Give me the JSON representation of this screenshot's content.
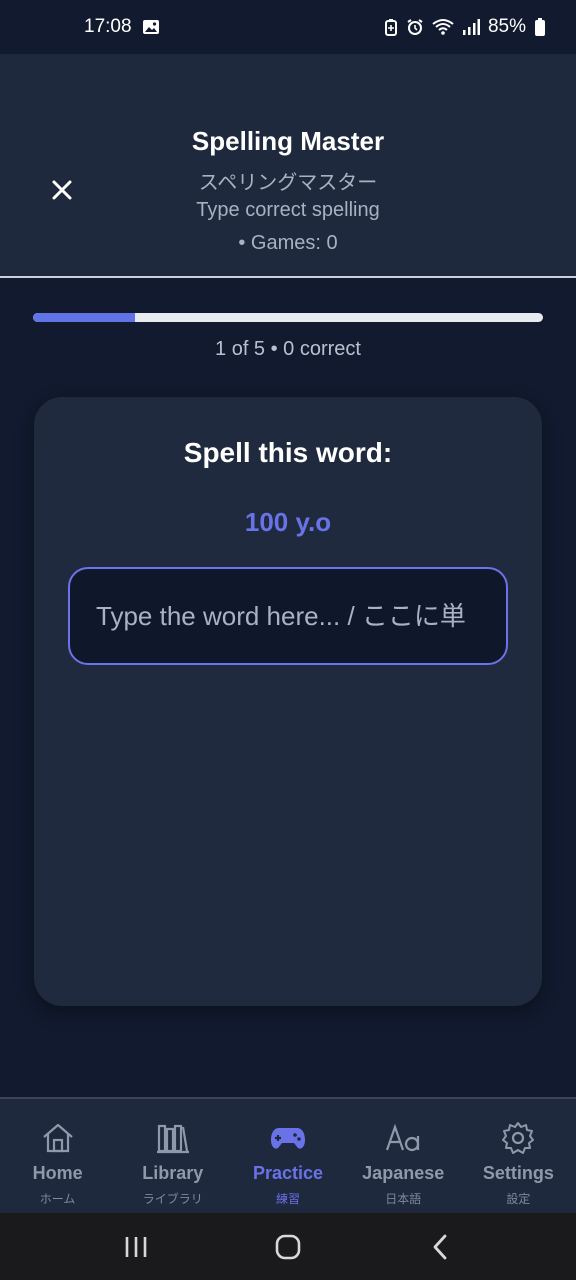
{
  "status": {
    "time": "17:08",
    "battery": "85%"
  },
  "header": {
    "title": "Spelling Master",
    "subtitle_jp": "スペリングマスター",
    "description": "Type correct spelling",
    "games": "• Games: 0"
  },
  "progress": {
    "fraction": 0.2,
    "text": "1 of 5 • 0 correct"
  },
  "card": {
    "title": "Spell this word:",
    "word": "100 y.o",
    "input_value": "",
    "input_placeholder": "Type the word here... / ここに単"
  },
  "nav": {
    "items": [
      {
        "label": "Home",
        "sub": "ホーム",
        "icon": "home-icon"
      },
      {
        "label": "Library",
        "sub": "ライブラリ",
        "icon": "library-icon"
      },
      {
        "label": "Practice",
        "sub": "練習",
        "icon": "gamepad-icon",
        "active": true
      },
      {
        "label": "Japanese",
        "sub": "日本語",
        "icon": "text-aa-icon"
      },
      {
        "label": "Settings",
        "sub": "設定",
        "icon": "gear-icon"
      }
    ]
  },
  "colors": {
    "accent": "#6a72e8",
    "background": "#111a2e",
    "surface": "#1f2a3e"
  }
}
